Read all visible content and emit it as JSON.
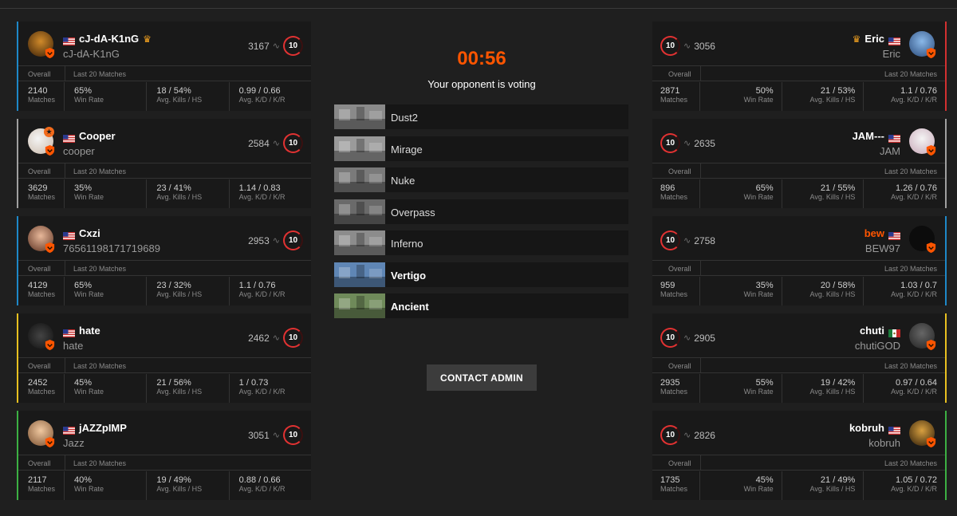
{
  "timer": "00:56",
  "status": "Your opponent is voting",
  "contact_admin": "CONTACT ADMIN",
  "labels": {
    "overall": "Overall",
    "last20": "Last 20 Matches",
    "matches": "Matches",
    "win_rate": "Win Rate",
    "avg_kills_hs": "Avg. Kills / HS",
    "avg_kd_kr": "Avg. K/D / K/R"
  },
  "maps": [
    {
      "name": "Dust2",
      "tint": "#8a8a8a"
    },
    {
      "name": "Mirage",
      "tint": "#9a9a9a"
    },
    {
      "name": "Nuke",
      "tint": "#7a7a7a"
    },
    {
      "name": "Overpass",
      "tint": "#6a6a6a"
    },
    {
      "name": "Inferno",
      "tint": "#8c8c8c"
    },
    {
      "name": "Vertigo",
      "tint": "#5f86b5"
    },
    {
      "name": "Ancient",
      "tint": "#6f8a5a"
    }
  ],
  "team_left": [
    {
      "nickname": "cJ-dA-K1nG",
      "subname": "cJ-dA-K1nG",
      "elo": "3167",
      "level": "10",
      "captain": true,
      "accent": "#1e88c8",
      "flag": "us",
      "matches": "2140",
      "win_rate": "65%",
      "kills_hs": "18 / 54%",
      "kd_kr": "0.99 / 0.66"
    },
    {
      "nickname": "Cooper",
      "subname": "cooper",
      "elo": "2584",
      "level": "10",
      "captain": false,
      "accent": "#a0a0a0",
      "flag": "us",
      "matches": "3629",
      "win_rate": "35%",
      "kills_hs": "23 / 41%",
      "kd_kr": "1.14 / 0.83"
    },
    {
      "nickname": "Cxzi",
      "subname": "76561198171719689",
      "elo": "2953",
      "level": "10",
      "captain": false,
      "accent": "#1e88c8",
      "flag": "us",
      "matches": "4129",
      "win_rate": "65%",
      "kills_hs": "23 / 32%",
      "kd_kr": "1.1 / 0.76"
    },
    {
      "nickname": "hate",
      "subname": "hate",
      "elo": "2462",
      "level": "10",
      "captain": false,
      "accent": "#e8c020",
      "flag": "us",
      "matches": "2452",
      "win_rate": "45%",
      "kills_hs": "21 / 56%",
      "kd_kr": "1 / 0.73"
    },
    {
      "nickname": "jAZZpIMP",
      "subname": "Jazz",
      "elo": "3051",
      "level": "10",
      "captain": false,
      "accent": "#3cb043",
      "flag": "us",
      "matches": "2117",
      "win_rate": "40%",
      "kills_hs": "19 / 49%",
      "kd_kr": "0.88 / 0.66"
    }
  ],
  "team_right": [
    {
      "nickname": "Eric",
      "subname": "Eric",
      "elo": "3056",
      "level": "10",
      "captain": true,
      "accent": "#d23030",
      "flag": "us",
      "matches": "2871",
      "win_rate": "50%",
      "kills_hs": "21 / 53%",
      "kd_kr": "1.1 / 0.76"
    },
    {
      "nickname": "JAM---",
      "subname": "JAM",
      "elo": "2635",
      "level": "10",
      "captain": false,
      "accent": "#a0a0a0",
      "flag": "us",
      "matches": "896",
      "win_rate": "65%",
      "kills_hs": "21 / 55%",
      "kd_kr": "1.26 / 0.76"
    },
    {
      "nickname": "bew",
      "subname": "BEW97",
      "elo": "2758",
      "level": "10",
      "captain": false,
      "accent": "#1e88c8",
      "flag": "us",
      "matches": "959",
      "win_rate": "35%",
      "kills_hs": "20 / 58%",
      "kd_kr": "1.03 / 0.7"
    },
    {
      "nickname": "chuti",
      "subname": "chutiGOD",
      "elo": "2905",
      "level": "10",
      "captain": false,
      "accent": "#e8c020",
      "flag": "mx",
      "matches": "2935",
      "win_rate": "55%",
      "kills_hs": "19 / 42%",
      "kd_kr": "0.97 / 0.64"
    },
    {
      "nickname": "kobruh",
      "subname": "kobruh",
      "elo": "2826",
      "level": "10",
      "captain": false,
      "accent": "#3cb043",
      "flag": "us",
      "matches": "1735",
      "win_rate": "45%",
      "kills_hs": "21 / 49%",
      "kd_kr": "1.05 / 0.72"
    }
  ]
}
